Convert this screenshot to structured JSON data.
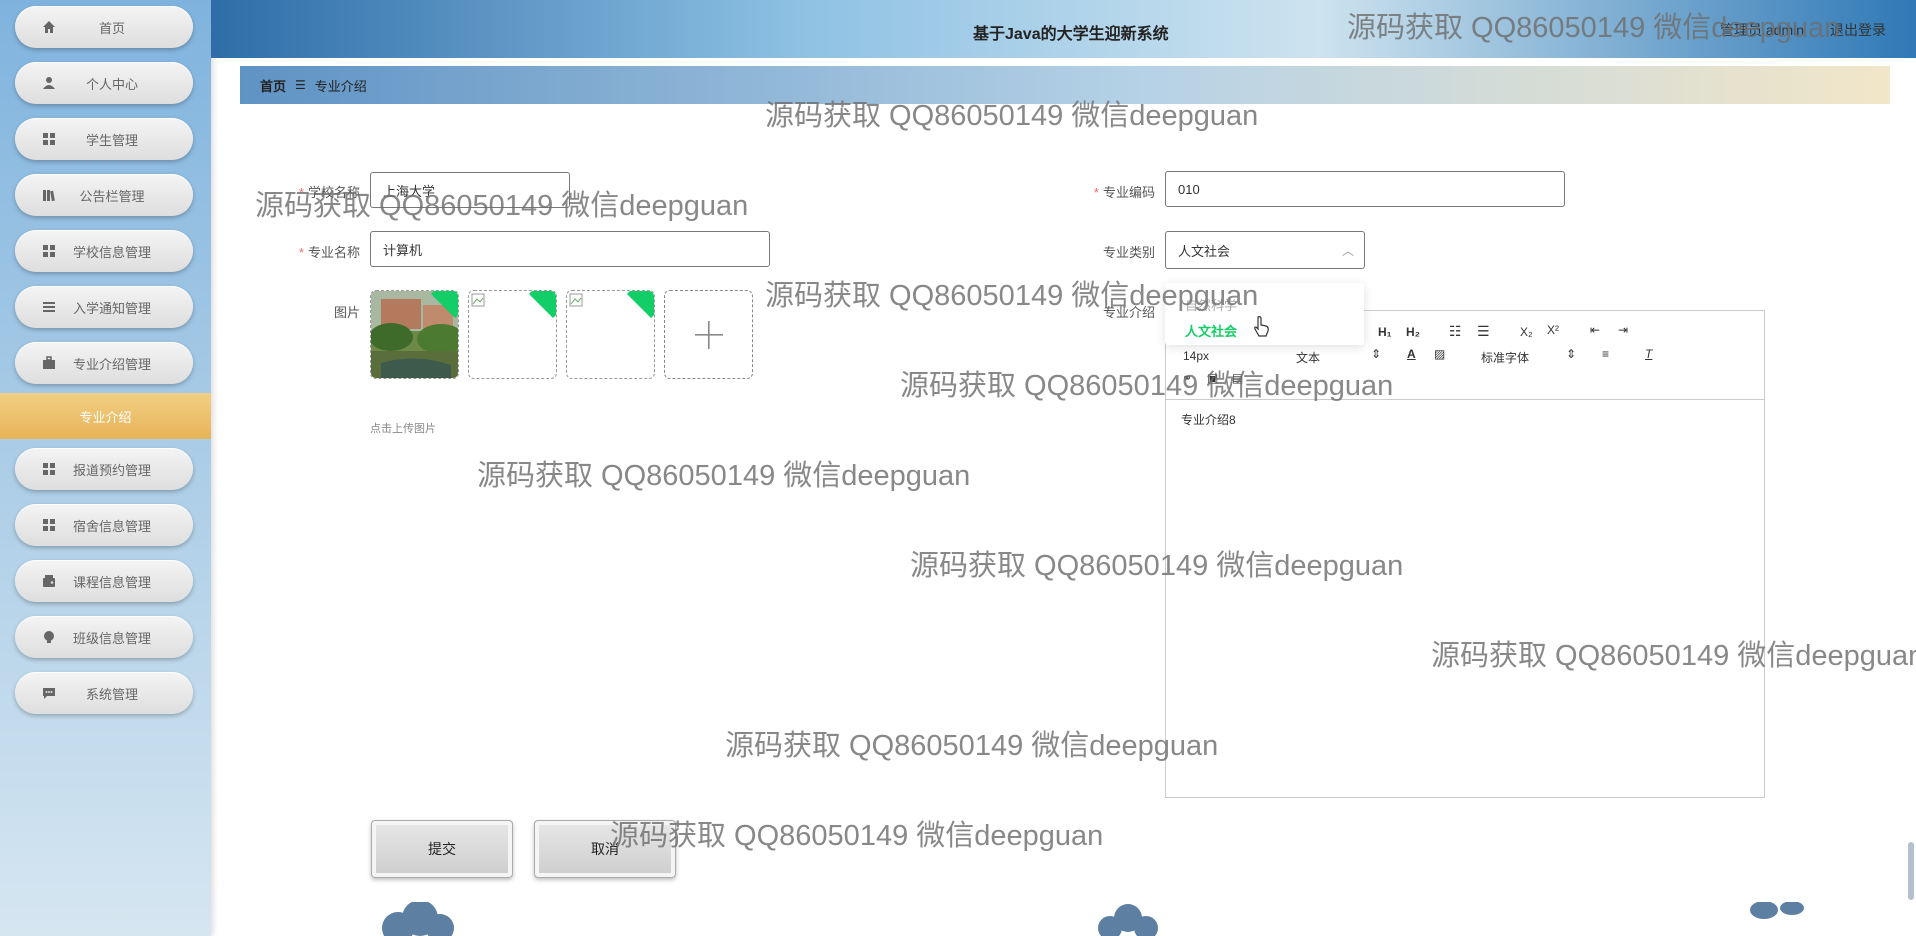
{
  "header": {
    "title": "基于Java的大学生迎新系统",
    "user": "管理员 admin",
    "logout": "退出登录"
  },
  "sidebar": {
    "items": [
      {
        "label": "首页",
        "icon": "home-icon"
      },
      {
        "label": "个人中心",
        "icon": "user-icon"
      },
      {
        "label": "学生管理",
        "icon": "grid-icon"
      },
      {
        "label": "公告栏管理",
        "icon": "book-icon"
      },
      {
        "label": "学校信息管理",
        "icon": "grid-icon"
      },
      {
        "label": "入学通知管理",
        "icon": "list-icon"
      },
      {
        "label": "专业介绍管理",
        "icon": "briefcase-icon"
      },
      {
        "label": "报道预约管理",
        "icon": "grid-icon"
      },
      {
        "label": "宿舍信息管理",
        "icon": "grid-icon"
      },
      {
        "label": "课程信息管理",
        "icon": "wallet-icon"
      },
      {
        "label": "班级信息管理",
        "icon": "bulb-icon"
      },
      {
        "label": "系统管理",
        "icon": "chat-icon"
      }
    ],
    "active_sub": "专业介绍"
  },
  "breadcrumb": {
    "home": "首页",
    "separator": "☰",
    "current": "专业介绍"
  },
  "form": {
    "school_name": {
      "label": "学校名称",
      "value": "上海大学"
    },
    "major_code": {
      "label": "专业编码",
      "value": "010"
    },
    "major_name": {
      "label": "专业名称",
      "value": "计算机"
    },
    "major_type": {
      "label": "专业类别",
      "value": "人文社会",
      "options": [
        "自然科学",
        "人文社会"
      ]
    },
    "picture": {
      "label": "图片",
      "hint": "点击上传图片"
    },
    "intro": {
      "label": "专业介绍",
      "content": "专业介绍8"
    }
  },
  "editor": {
    "font_size": "14px",
    "format": "文本",
    "font_family": "标准字体"
  },
  "buttons": {
    "submit": "提交",
    "cancel": "取消"
  },
  "watermark": "源码获取 QQ86050149 微信deepguan",
  "colors": {
    "accent": "#13ce66",
    "active_menu": "#e9b95f"
  }
}
